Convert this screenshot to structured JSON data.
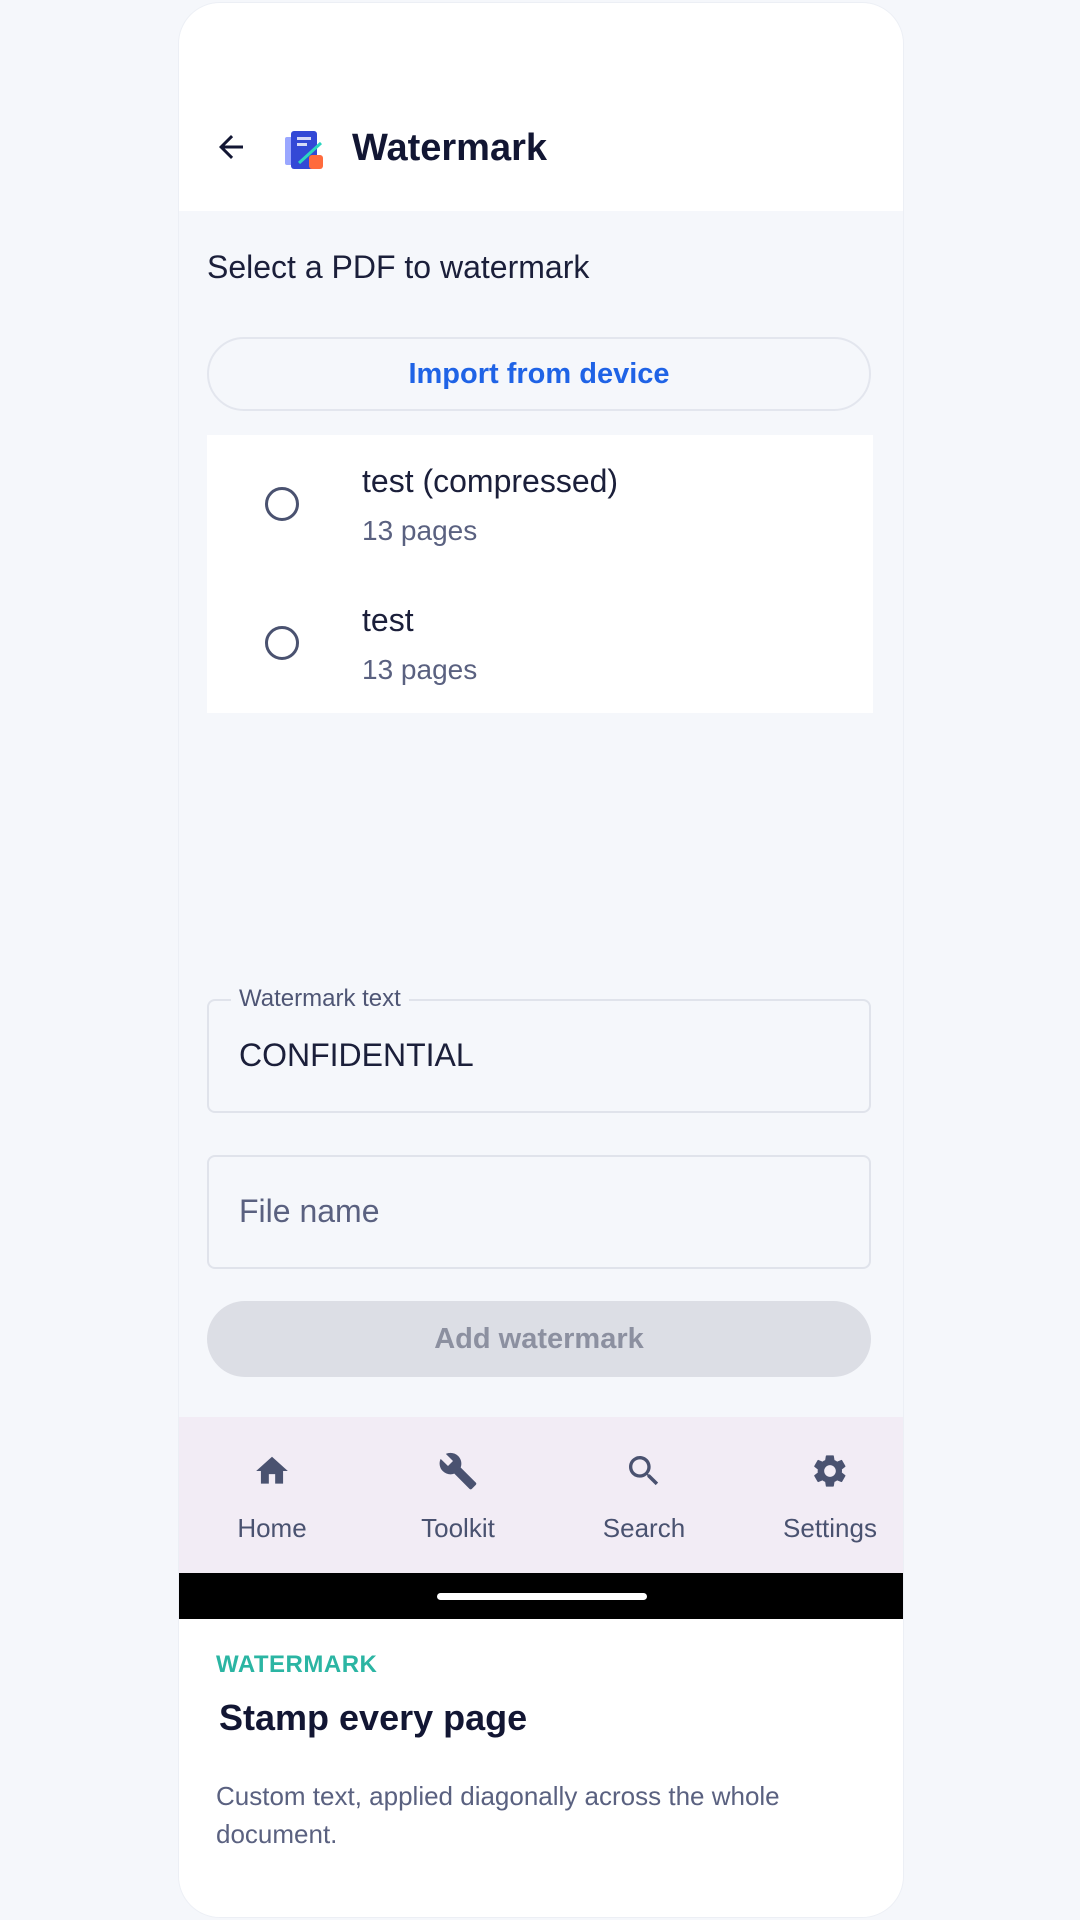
{
  "header": {
    "title": "Watermark",
    "back_icon": "arrow-left-icon",
    "logo_icon": "pdf-app-logo"
  },
  "main": {
    "prompt": "Select a PDF to watermark",
    "import_label": "Import from device",
    "files": [
      {
        "name": "test (compressed)",
        "pages": "13 pages",
        "selected": false
      },
      {
        "name": "test",
        "pages": "13 pages",
        "selected": false
      }
    ],
    "watermark_field": {
      "label": "Watermark text",
      "value": "CONFIDENTIAL"
    },
    "filename_field": {
      "placeholder": "File name",
      "value": ""
    },
    "submit_label": "Add watermark"
  },
  "nav": {
    "items": [
      {
        "label": "Home",
        "icon": "home-icon"
      },
      {
        "label": "Toolkit",
        "icon": "wrench-icon"
      },
      {
        "label": "Search",
        "icon": "search-icon"
      },
      {
        "label": "Settings",
        "icon": "gear-icon"
      }
    ]
  },
  "feature": {
    "eyebrow": "WATERMARK",
    "title": "Stamp every page",
    "description": "Custom text, applied diagonally across the whole document."
  },
  "colors": {
    "accent_blue": "#1f63e6",
    "teal": "#2bb5a3",
    "nav_background": "#f2ecf5",
    "disabled_button": "#dcdee5"
  }
}
